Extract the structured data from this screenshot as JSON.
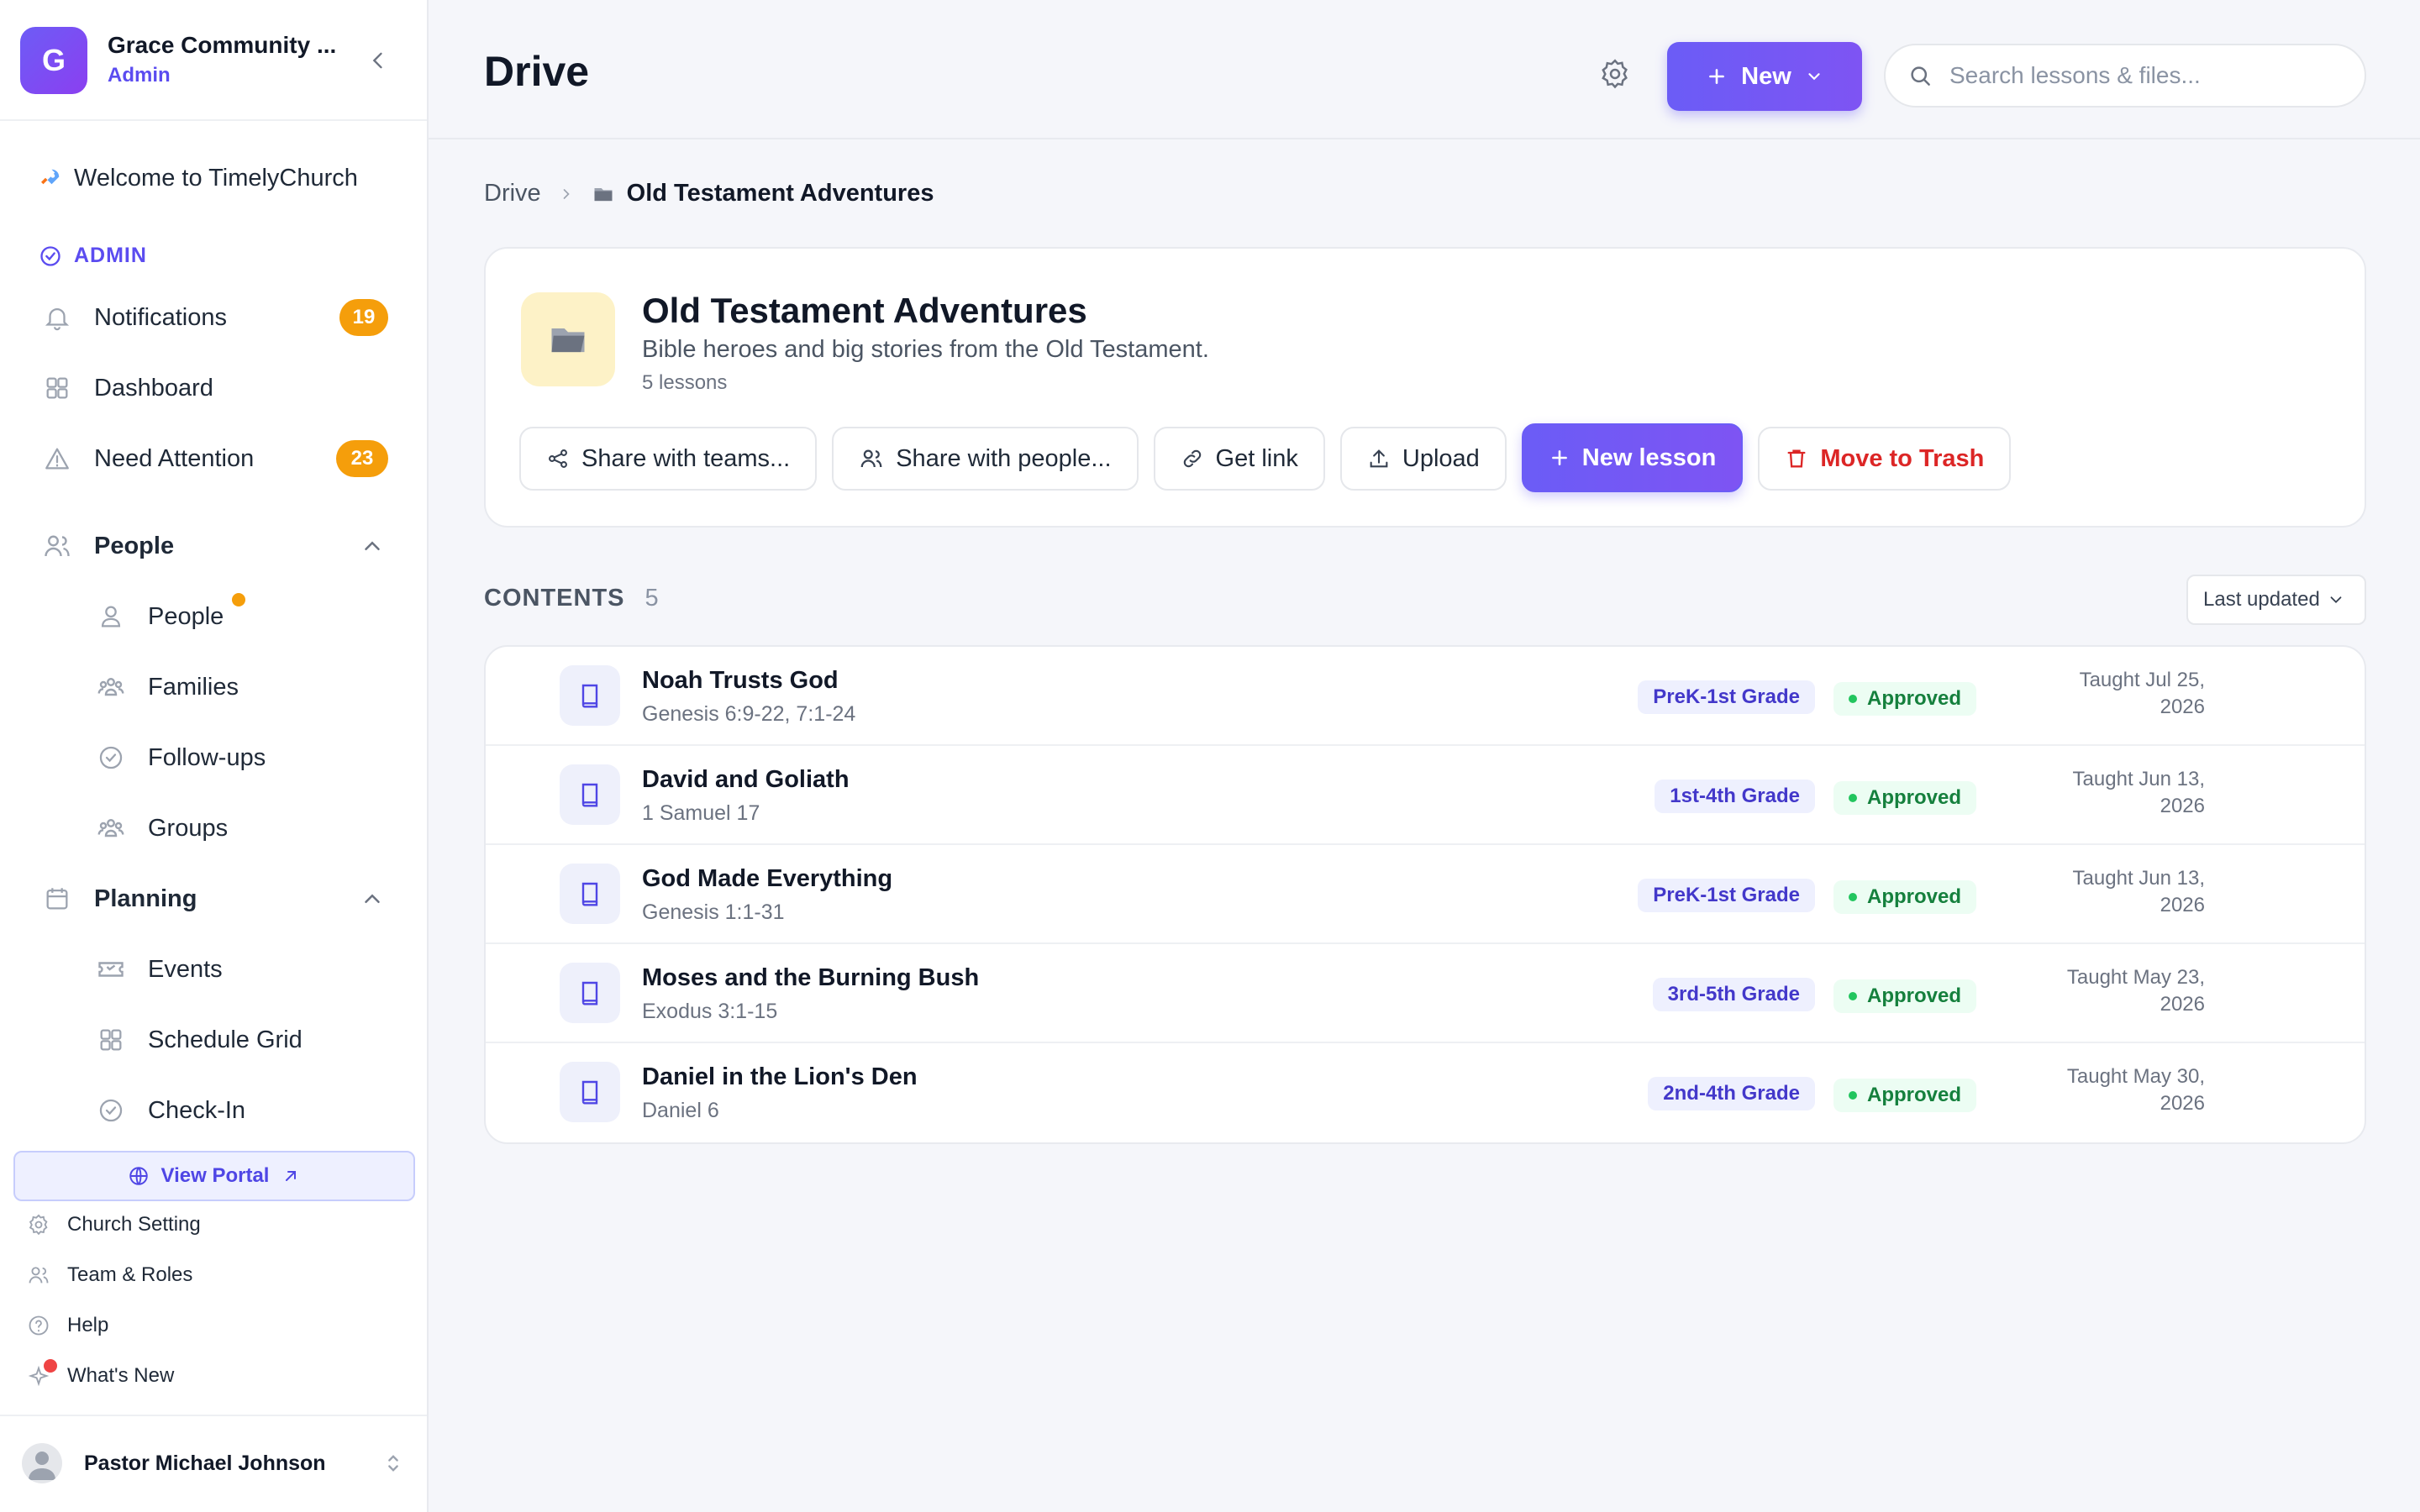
{
  "org": {
    "initial": "G",
    "name": "Grace Community ...",
    "role": "Admin"
  },
  "sidebar": {
    "welcome": "Welcome to TimelyChurch",
    "admin_label": "ADMIN",
    "notifications": {
      "label": "Notifications",
      "badge": "19"
    },
    "dashboard": "Dashboard",
    "need_attention": {
      "label": "Need Attention",
      "badge": "23"
    },
    "people_group": "People",
    "people_items": [
      "People",
      "Families",
      "Follow-ups",
      "Groups"
    ],
    "planning_group": "Planning",
    "planning_items": [
      "Events",
      "Schedule Grid",
      "Check-In"
    ],
    "view_portal": "View Portal",
    "links": [
      "Church Setting",
      "Team & Roles",
      "Help",
      "What's New"
    ],
    "user": "Pastor Michael Johnson"
  },
  "header": {
    "title": "Drive",
    "new_label": "New",
    "search_placeholder": "Search lessons & files..."
  },
  "breadcrumb": {
    "root": "Drive",
    "current": "Old Testament Adventures"
  },
  "folder": {
    "title": "Old Testament Adventures",
    "description": "Bible heroes and big stories from the Old Testament.",
    "count": "5 lessons",
    "actions": {
      "share_teams": "Share with teams...",
      "share_people": "Share with people...",
      "get_link": "Get link",
      "upload": "Upload",
      "new_lesson": "New lesson",
      "trash": "Move to Trash"
    }
  },
  "contents": {
    "label": "CONTENTS",
    "count": "5",
    "sort": "Last updated"
  },
  "lessons": [
    {
      "title": "Noah Trusts God",
      "ref": "Genesis 6:9-22, 7:1-24",
      "grade": "PreK-1st Grade",
      "status": "Approved",
      "taught_1": "Taught Jul 25,",
      "taught_2": "2026"
    },
    {
      "title": "David and Goliath",
      "ref": "1 Samuel 17",
      "grade": "1st-4th Grade",
      "status": "Approved",
      "taught_1": "Taught Jun 13,",
      "taught_2": "2026"
    },
    {
      "title": "God Made Everything",
      "ref": "Genesis 1:1-31",
      "grade": "PreK-1st Grade",
      "status": "Approved",
      "taught_1": "Taught Jun 13,",
      "taught_2": "2026"
    },
    {
      "title": "Moses and the Burning Bush",
      "ref": "Exodus 3:1-15",
      "grade": "3rd-5th Grade",
      "status": "Approved",
      "taught_1": "Taught May 23,",
      "taught_2": "2026"
    },
    {
      "title": "Daniel in the Lion's Den",
      "ref": "Daniel 6",
      "grade": "2nd-4th Grade",
      "status": "Approved",
      "taught_1": "Taught May 30,",
      "taught_2": "2026"
    }
  ],
  "colors": {
    "accent": "#6b5cf6",
    "badge": "#f59e0b",
    "danger": "#dc2626",
    "success": "#15803d"
  }
}
